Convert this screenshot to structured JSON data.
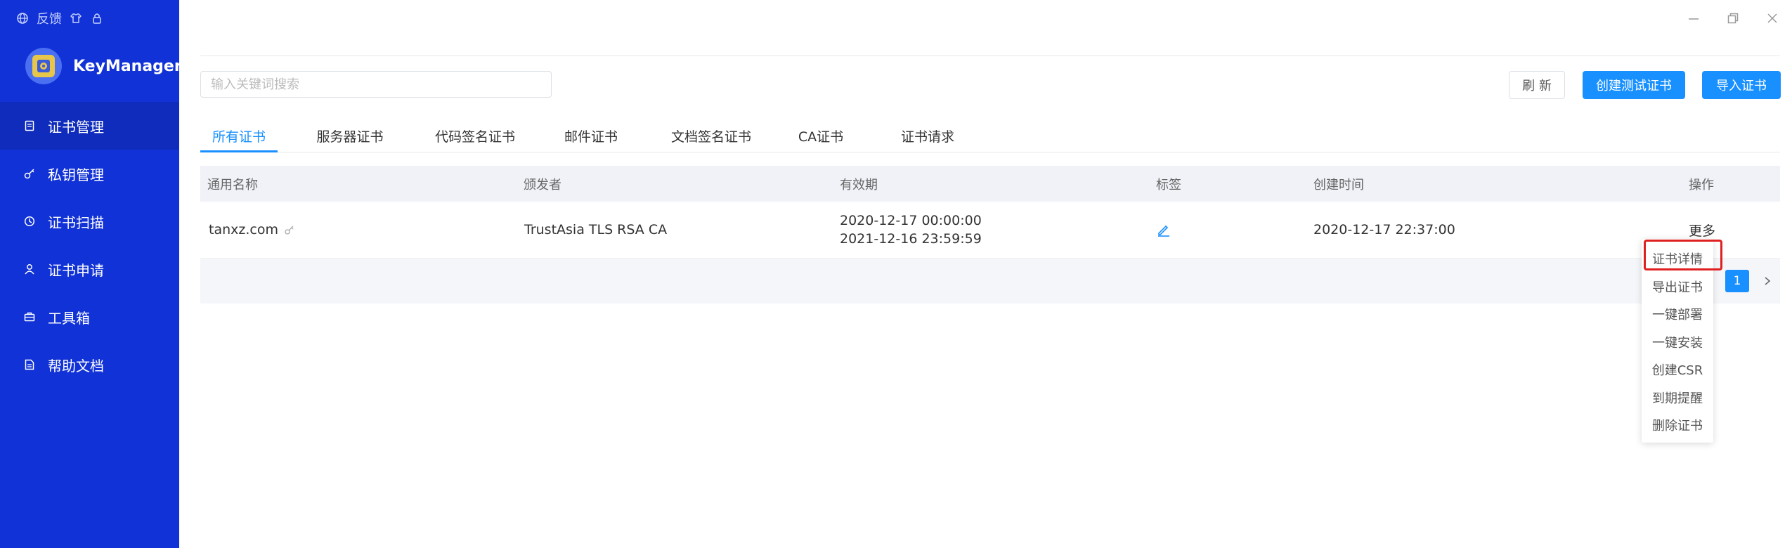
{
  "sidebar": {
    "top_feedback": "反馈",
    "brand": "KeyManager",
    "items": [
      {
        "label": "证书管理"
      },
      {
        "label": "私钥管理"
      },
      {
        "label": "证书扫描"
      },
      {
        "label": "证书申请"
      },
      {
        "label": "工具箱"
      },
      {
        "label": "帮助文档"
      }
    ]
  },
  "toolbar": {
    "search_placeholder": "输入关键词搜索",
    "refresh_label": "刷 新",
    "create_test_label": "创建测试证书",
    "import_label": "导入证书"
  },
  "tabs": [
    "所有证书",
    "服务器证书",
    "代码签名证书",
    "邮件证书",
    "文档签名证书",
    "CA证书",
    "证书请求"
  ],
  "table": {
    "headers": [
      "通用名称",
      "颁发者",
      "有效期",
      "标签",
      "创建时间",
      "操作"
    ],
    "rows": [
      {
        "common_name": "tanxz.com",
        "issuer": "TrustAsia TLS RSA CA",
        "valid_from": "2020-12-17 00:00:00",
        "valid_to": "2021-12-16 23:59:59",
        "created": "2020-12-17 22:37:00",
        "action": "更多"
      }
    ]
  },
  "pagination": {
    "current": "1",
    "next": "›"
  },
  "dropdown": [
    "证书详情",
    "导出证书",
    "一键部署",
    "一键安装",
    "创建CSR",
    "到期提醒",
    "删除证书"
  ],
  "colors": {
    "sidebar": "#1132d6",
    "primary": "#1890ff",
    "highlight": "#e02020"
  }
}
